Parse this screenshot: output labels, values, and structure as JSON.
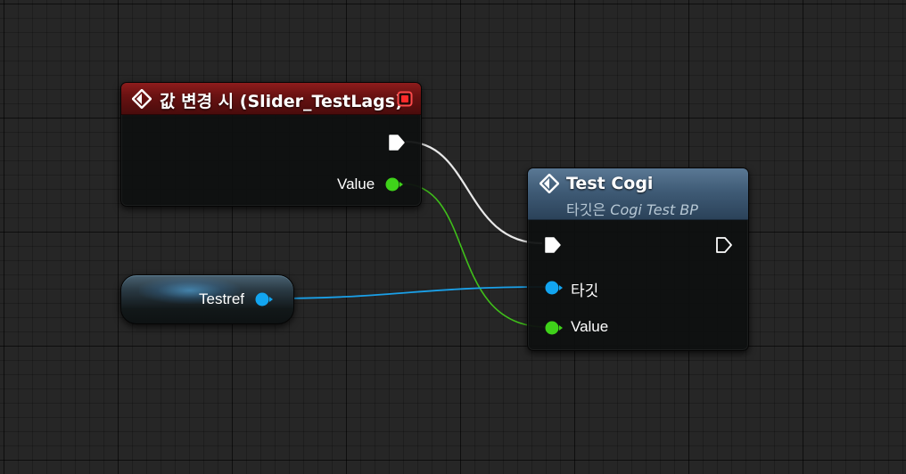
{
  "event_node": {
    "title": "값 변경 시 (Slider_TestLags)",
    "icon": "event-diamond-icon",
    "close_icon": "stop-square-icon",
    "pins": {
      "exec_out": "exec-out-pin",
      "value_out_label": "Value"
    },
    "header_color": "#8e1c1c"
  },
  "function_node": {
    "title": "Test Cogi",
    "subtitle_prefix": "타깃은",
    "subtitle_target": "Cogi Test BP",
    "icon": "function-diamond-icon",
    "pins": {
      "exec_in": "exec-in-pin",
      "exec_out": "exec-out-pin",
      "target_label": "타깃",
      "value_label": "Value"
    },
    "header_color": "#3f5b76"
  },
  "variable_node": {
    "label": "Testref",
    "pin": "object-ref-pin"
  },
  "colors": {
    "exec_wire": "#ffffff",
    "float_wire": "#3fbf1a",
    "object_wire": "#1aa0e8",
    "float_pin": "#3fd21a",
    "object_pin": "#12a5f0",
    "grid_background": "#262626"
  }
}
